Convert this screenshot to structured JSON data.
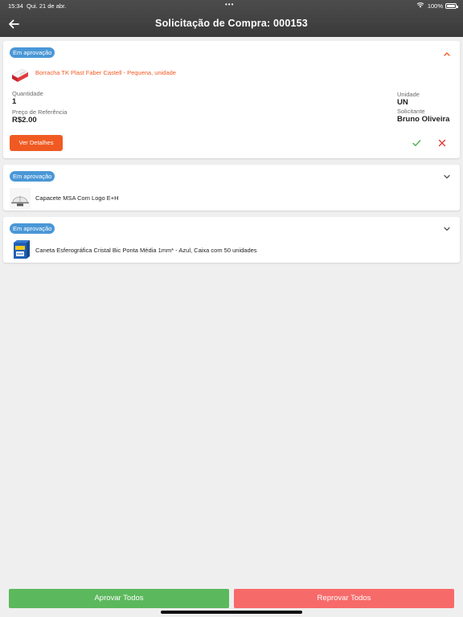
{
  "status_bar": {
    "time": "15:34",
    "date": "Qui. 21 de abr.",
    "battery": "100%"
  },
  "header": {
    "title": "Solicitação de Compra: 000153"
  },
  "colors": {
    "accent": "#f05a22",
    "badge": "#4a97d6",
    "approve": "#5cb85c",
    "reject": "#f76a6a",
    "header": "#404040"
  },
  "items": [
    {
      "status": "Em aprovação",
      "product": "Borracha TK Plast Faber Castell - Pequena, unidade",
      "expanded": true,
      "quantity_label": "Quantidade",
      "quantity": "1",
      "price_label": "Preço de Referência",
      "price": "R$2.00",
      "unit_label": "Unidade",
      "unit": "UN",
      "requester_label": "Solicitante",
      "requester": "Bruno Oliveira",
      "details_button": "Ver Detalhes",
      "icons": [
        "eraser-image",
        "chevron-up-icon",
        "check-icon",
        "close-icon"
      ]
    },
    {
      "status": "Em aprovação",
      "product": "Capacete MSA Com Logo E+H",
      "expanded": false,
      "icons": [
        "helmet-image",
        "chevron-down-icon"
      ]
    },
    {
      "status": "Em aprovação",
      "product": "Caneta Esferográfica Cristal Bic Ponta Média 1mm* - Azul, Caixa com 50 unidades",
      "expanded": false,
      "icons": [
        "pen-box-image",
        "chevron-down-icon"
      ]
    }
  ],
  "footer": {
    "approve_all": "Aprovar Todos",
    "reject_all": "Reprovar Todos"
  }
}
